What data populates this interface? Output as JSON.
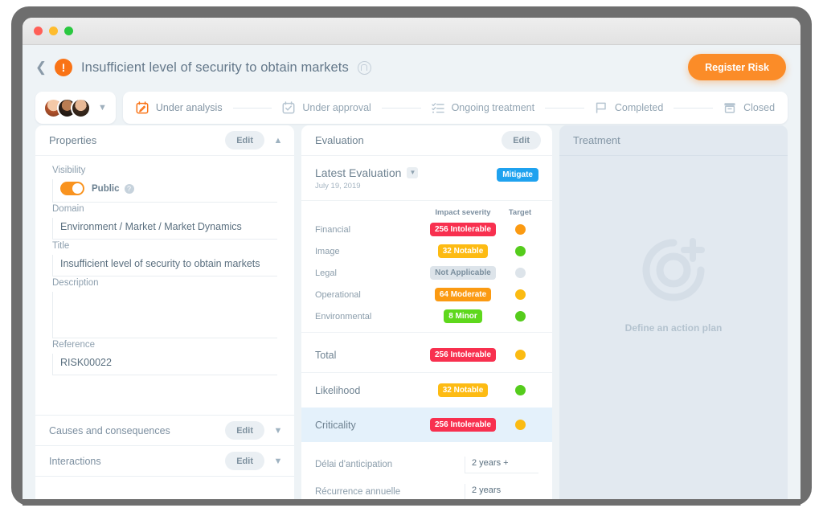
{
  "window": {
    "buttons": [
      "close",
      "minimize",
      "maximize"
    ]
  },
  "header": {
    "back_icon": "chevron-left-icon",
    "risk_icon": "exclamation-icon",
    "risk_icon_glyph": "!",
    "title": "Insufficient level of security to obtain markets",
    "lock_icon": "lock-icon",
    "register_button": "Register Risk",
    "accent_color": "#fb8c28"
  },
  "workflow": {
    "avatars_caret": "chevron-down-icon",
    "steps": [
      {
        "label": "Under analysis",
        "icon": "calendar-edit-icon",
        "active": true
      },
      {
        "label": "Under approval",
        "icon": "calendar-check-icon",
        "active": false
      },
      {
        "label": "Ongoing treatment",
        "icon": "checklist-icon",
        "active": false
      },
      {
        "label": "Completed",
        "icon": "flag-icon",
        "active": false
      },
      {
        "label": "Closed",
        "icon": "archive-icon",
        "active": false
      }
    ]
  },
  "properties": {
    "title": "Properties",
    "edit_label": "Edit",
    "collapse_icon": "chevron-up-icon",
    "fields": [
      {
        "label": "Visibility",
        "value": "Public",
        "type": "toggle",
        "toggle_on": true,
        "info_icon": "info-icon"
      },
      {
        "label": "Domain",
        "value": "Environment / Market / Market Dynamics",
        "type": "text"
      },
      {
        "label": "Title",
        "value": "Insufficient level of security to obtain markets",
        "type": "text"
      },
      {
        "label": "Description",
        "value": "",
        "type": "textarea"
      },
      {
        "label": "Reference",
        "value": "RISK00022",
        "type": "text"
      }
    ],
    "collapsed_sections": [
      {
        "label": "Causes and consequences",
        "edit_label": "Edit",
        "chevron": "chevron-down-icon"
      },
      {
        "label": "Interactions",
        "edit_label": "Edit",
        "chevron": "chevron-down-icon"
      }
    ]
  },
  "evaluation": {
    "title": "Evaluation",
    "edit_label": "Edit",
    "subtitle": "Latest Evaluation",
    "subtitle_caret": "chevron-down-icon",
    "date": "July 19, 2019",
    "strategy_badge": "Mitigate",
    "strategy_badge_color": "#1fa2ef",
    "columns": [
      "Impact severity",
      "Target"
    ],
    "rows": [
      {
        "name": "Financial",
        "severity": "256 Intolerable",
        "severity_color": "#f8304f",
        "target_color": "#fb9a12"
      },
      {
        "name": "Image",
        "severity": "32 Notable",
        "severity_color": "#fdbb13",
        "target_color": "#55cc1c"
      },
      {
        "name": "Legal",
        "severity": "Not Applicable",
        "severity_color": "#dde4ea",
        "severity_text_color": "#7b8f9e",
        "target_color": "#dde4ea"
      },
      {
        "name": "Operational",
        "severity": "64 Moderate",
        "severity_color": "#fb9a12",
        "target_color": "#fbbb12"
      },
      {
        "name": "Environmental",
        "severity": "8 Minor",
        "severity_color": "#5ed81c",
        "target_color": "#55cc1c"
      }
    ],
    "summary_rows": [
      {
        "name": "Total",
        "severity": "256 Intolerable",
        "severity_color": "#f8304f",
        "target_color": "#fbbb12",
        "highlight": false
      },
      {
        "name": "Likelihood",
        "severity": "32 Notable",
        "severity_color": "#fdbb13",
        "target_color": "#55cc1c",
        "highlight": false
      },
      {
        "name": "Criticality",
        "severity": "256 Intolerable",
        "severity_color": "#f8304f",
        "target_color": "#fbbb12",
        "highlight": true
      }
    ],
    "extra_fields": [
      {
        "label": "Délai d'anticipation",
        "value": "2 years +"
      },
      {
        "label": "Récurrence annuelle",
        "value": "2 years"
      }
    ]
  },
  "treatment": {
    "title": "Treatment",
    "empty_icon": "target-add-icon",
    "empty_label": "Define an action plan"
  }
}
